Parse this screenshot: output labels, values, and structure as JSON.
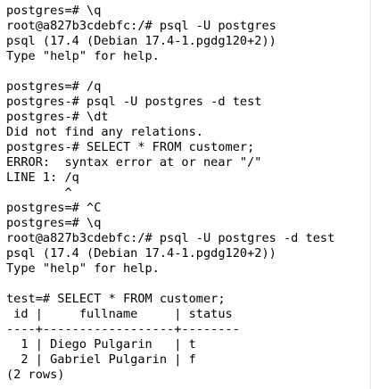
{
  "terminal": {
    "lines": [
      "postgres=# \\q",
      "root@a827b3cdebfc:/# psql -U postgres",
      "psql (17.4 (Debian 17.4-1.pgdg120+2))",
      "Type \"help\" for help.",
      "",
      "postgres=# /q",
      "postgres-# psql -U postgres -d test",
      "postgres-# \\dt",
      "Did not find any relations.",
      "postgres-# SELECT * FROM customer;",
      "ERROR:  syntax error at or near \"/\"",
      "LINE 1: /q",
      "        ^",
      "postgres=# ^C",
      "postgres=# \\q",
      "root@a827b3cdebfc:/# psql -U postgres -d test",
      "psql (17.4 (Debian 17.4-1.pgdg120+2))",
      "Type \"help\" for help.",
      "",
      "test=# SELECT * FROM customer;",
      " id |     fullname     | status",
      "----+------------------+--------",
      "  1 | Diego Pulgarin   | t",
      "  2 | Gabriel Pulgarin | f",
      "(2 rows)"
    ]
  }
}
